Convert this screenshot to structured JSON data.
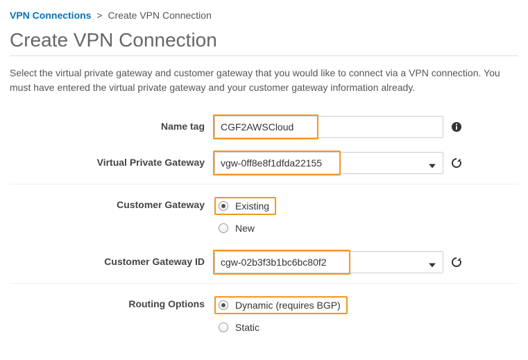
{
  "breadcrumb": {
    "root": "VPN Connections",
    "sep": ">",
    "current": "Create VPN Connection"
  },
  "title": "Create VPN Connection",
  "description": "Select the virtual private gateway and customer gateway that you would like to connect via a VPN connection. You must have entered the virtual private gateway and your customer gateway information already.",
  "fields": {
    "name_tag": {
      "label": "Name tag",
      "value": "CGF2AWSCloud"
    },
    "vpg": {
      "label": "Virtual Private Gateway",
      "value": "vgw-0ff8e8f1dfda22155"
    },
    "customer_gateway": {
      "label": "Customer Gateway",
      "options": [
        {
          "label": "Existing",
          "selected": true
        },
        {
          "label": "New",
          "selected": false
        }
      ]
    },
    "cgw_id": {
      "label": "Customer Gateway ID",
      "value": "cgw-02b3f3b1bc6bc80f2"
    },
    "routing": {
      "label": "Routing Options",
      "options": [
        {
          "label": "Dynamic (requires BGP)",
          "selected": true
        },
        {
          "label": "Static",
          "selected": false
        }
      ]
    }
  },
  "highlight_widths": {
    "name_tag": 152,
    "vpg": 184,
    "cgw_id": 198
  }
}
